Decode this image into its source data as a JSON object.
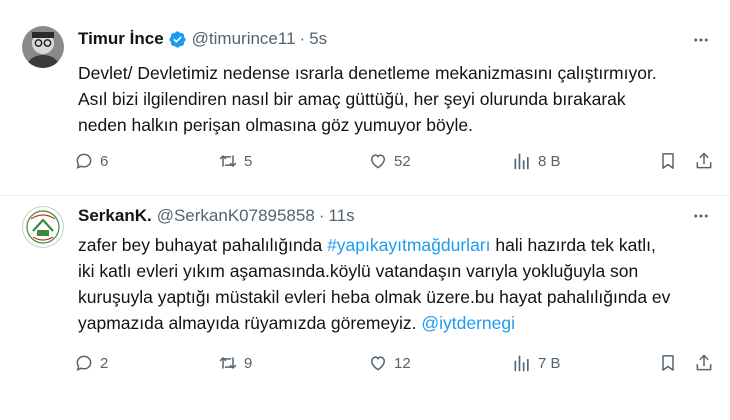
{
  "tweets": [
    {
      "name": "Timur İnce",
      "handle": "@timurince11",
      "separator": "·",
      "time": "5s",
      "verified": true,
      "avatar_icon": "person-photo-avatar",
      "text": "Devlet/ Devletimiz nedense ısrarla denetleme mekanizmasını çalıştırmıyor.\nAsıl bizi ilgilendiren nasıl bir amaç güttüğü, her şeyi olurunda bırakarak\nneden halkın perişan olmasına göz yumuyor böyle.",
      "stats": {
        "replies": "6",
        "retweets": "5",
        "likes": "52",
        "views": "8 B"
      }
    },
    {
      "name": "SerkanK.",
      "handle": "@SerkanK07895858",
      "separator": "·",
      "time": "11s",
      "verified": false,
      "avatar_icon": "association-logo-avatar",
      "text_before": "zafer bey buhayat pahalılığında ",
      "hashtag": "#yapıkayıtmağdurları",
      "text_middle": " hali hazırda tek katlı,\niki katlı evleri yıkım aşamasında.köylü vatandaşın varıyla yokluğuyla son\nkuruşuyla yaptığı müstakil evleri heba olmak üzere.bu hayat pahalılığında ev\nyapmazıda almayıda rüyamızda göremeyiz. ",
      "mention": "@iytdernegi",
      "stats": {
        "replies": "2",
        "retweets": "9",
        "likes": "12",
        "views": "7 B"
      }
    }
  ],
  "colors": {
    "text": "#0f1419",
    "secondary": "#536471",
    "link": "#1d9bf0",
    "divider": "#eff3f4",
    "avatar_logo_green": "#3a8a3a"
  },
  "icons": [
    "more-icon",
    "verified-badge-icon",
    "reply-icon",
    "retweet-icon",
    "like-icon",
    "views-icon",
    "bookmark-icon",
    "share-icon"
  ]
}
